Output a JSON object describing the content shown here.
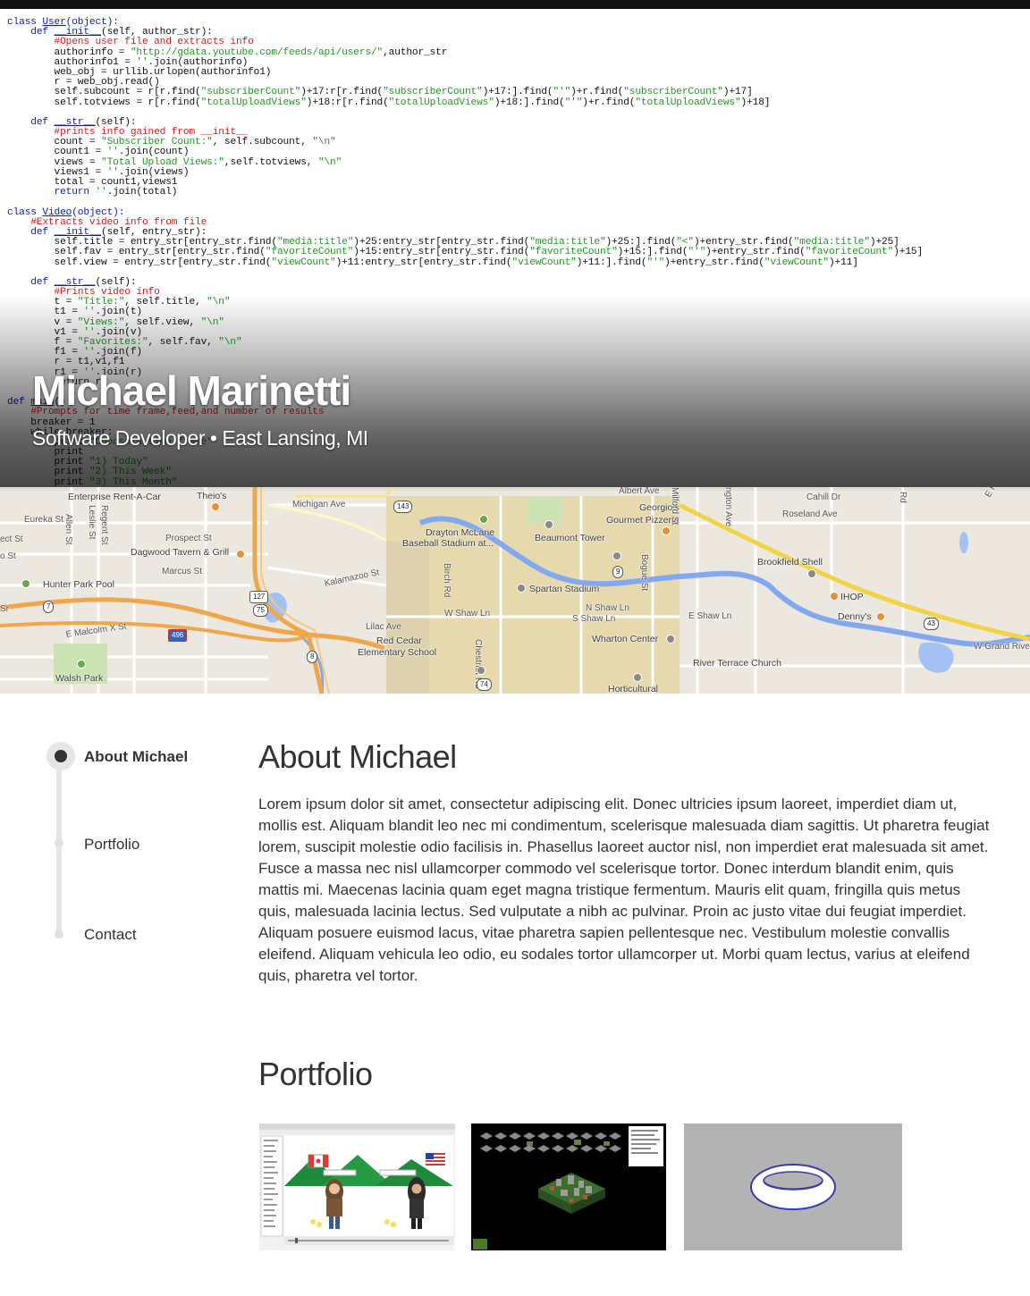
{
  "hero": {
    "name": "Michael Marinetti",
    "subtitle": "Software Developer • East Lansing, MI",
    "code_lines": [
      [
        [
          "k",
          "class "
        ],
        [
          "f",
          "User"
        ],
        [
          "k",
          "(object):"
        ]
      ],
      [
        [
          "k",
          "    def "
        ],
        [
          "f",
          "__init__"
        ],
        [
          "p",
          "(self, author_str):"
        ]
      ],
      [
        [
          "c",
          "        #Opens user file and extracts info"
        ]
      ],
      [
        [
          "p",
          "        authorinfo = "
        ],
        [
          "s",
          "\"http://gdata.youtube.com/feeds/api/users/\""
        ],
        [
          "p",
          ",author_str"
        ]
      ],
      [
        [
          "p",
          "        authorinfo1 = "
        ],
        [
          "s",
          "''"
        ],
        [
          "p",
          ".join(authorinfo)"
        ]
      ],
      [
        [
          "p",
          "        web_obj = urllib.urlopen(authorinfo1)"
        ]
      ],
      [
        [
          "p",
          "        r = web_obj.read()"
        ]
      ],
      [
        [
          "p",
          "        self.subcount = r[r.find("
        ],
        [
          "s",
          "\"subscriberCount\""
        ],
        [
          "p",
          ")+17:r[r.find("
        ],
        [
          "s",
          "\"subscriberCount\""
        ],
        [
          "p",
          ")+17:].find("
        ],
        [
          "s",
          "\"'\""
        ],
        [
          "p",
          ")+r.find("
        ],
        [
          "s",
          "\"subscriberCount\""
        ],
        [
          "p",
          ")+17]"
        ]
      ],
      [
        [
          "p",
          "        self.totviews = r[r.find("
        ],
        [
          "s",
          "\"totalUploadViews\""
        ],
        [
          "p",
          ")+18:r[r.find("
        ],
        [
          "s",
          "\"totalUploadViews\""
        ],
        [
          "p",
          ")+18:].find("
        ],
        [
          "s",
          "\"'\""
        ],
        [
          "p",
          ")+r.find("
        ],
        [
          "s",
          "\"totalUploadViews\""
        ],
        [
          "p",
          ")+18]"
        ]
      ],
      [
        [
          "p",
          ""
        ]
      ],
      [
        [
          "k",
          "    def "
        ],
        [
          "f",
          "__str__"
        ],
        [
          "p",
          "(self):"
        ]
      ],
      [
        [
          "c",
          "        #prints info gained from __init__"
        ]
      ],
      [
        [
          "p",
          "        count = "
        ],
        [
          "s",
          "\"Subscriber Count:\""
        ],
        [
          "p",
          ", self.subcount, "
        ],
        [
          "s",
          "\"\\n\""
        ]
      ],
      [
        [
          "p",
          "        count1 = "
        ],
        [
          "s",
          "''"
        ],
        [
          "p",
          ".join(count)"
        ]
      ],
      [
        [
          "p",
          "        views = "
        ],
        [
          "s",
          "\"Total Upload Views:\""
        ],
        [
          "p",
          ",self.totviews, "
        ],
        [
          "s",
          "\"\\n\""
        ]
      ],
      [
        [
          "p",
          "        views1 = "
        ],
        [
          "s",
          "''"
        ],
        [
          "p",
          ".join(views)"
        ]
      ],
      [
        [
          "p",
          "        total = count1,views1"
        ]
      ],
      [
        [
          "k",
          "        return "
        ],
        [
          "s",
          "''"
        ],
        [
          "p",
          ".join(total)"
        ]
      ],
      [
        [
          "p",
          ""
        ]
      ],
      [
        [
          "k",
          "class "
        ],
        [
          "f",
          "Video"
        ],
        [
          "k",
          "(object):"
        ]
      ],
      [
        [
          "c",
          "    #Extracts video info from file"
        ]
      ],
      [
        [
          "k",
          "    def "
        ],
        [
          "f",
          "__init__"
        ],
        [
          "p",
          "(self, entry_str):"
        ]
      ],
      [
        [
          "p",
          "        self.title = entry_str[entry_str.find("
        ],
        [
          "s",
          "\"media:title\""
        ],
        [
          "p",
          ")+25:entry_str[entry_str.find("
        ],
        [
          "s",
          "\"media:title\""
        ],
        [
          "p",
          ")+25:].find("
        ],
        [
          "s",
          "\"<\""
        ],
        [
          "p",
          ")+entry_str.find("
        ],
        [
          "s",
          "\"media:title\""
        ],
        [
          "p",
          ")+25]"
        ]
      ],
      [
        [
          "p",
          "        self.fav = entry_str[entry_str.find("
        ],
        [
          "s",
          "\"favoriteCount\""
        ],
        [
          "p",
          ")+15:entry_str[entry_str.find("
        ],
        [
          "s",
          "\"favoriteCount\""
        ],
        [
          "p",
          ")+15:].find("
        ],
        [
          "s",
          "\"'\""
        ],
        [
          "p",
          ")+entry_str.find("
        ],
        [
          "s",
          "\"favoriteCount\""
        ],
        [
          "p",
          ")+15]"
        ]
      ],
      [
        [
          "p",
          "        self.view = entry_str[entry_str.find("
        ],
        [
          "s",
          "\"viewCount\""
        ],
        [
          "p",
          ")+11:entry_str[entry_str.find("
        ],
        [
          "s",
          "\"viewCount\""
        ],
        [
          "p",
          ")+11:].find("
        ],
        [
          "s",
          "\"'\""
        ],
        [
          "p",
          ")+entry_str.find("
        ],
        [
          "s",
          "\"viewCount\""
        ],
        [
          "p",
          ")+11]"
        ]
      ],
      [
        [
          "p",
          ""
        ]
      ],
      [
        [
          "k",
          "    def "
        ],
        [
          "f",
          "__str__"
        ],
        [
          "p",
          "(self):"
        ]
      ],
      [
        [
          "c",
          "        #Prints video info"
        ]
      ],
      [
        [
          "p",
          "        t = "
        ],
        [
          "s",
          "\"Title:\""
        ],
        [
          "p",
          ", self.title, "
        ],
        [
          "s",
          "\"\\n\""
        ]
      ],
      [
        [
          "p",
          "        t1 = "
        ],
        [
          "s",
          "''"
        ],
        [
          "p",
          ".join(t)"
        ]
      ],
      [
        [
          "p",
          "        v = "
        ],
        [
          "s",
          "\"Views:\""
        ],
        [
          "p",
          ", self.view, "
        ],
        [
          "s",
          "\"\\n\""
        ]
      ],
      [
        [
          "p",
          "        v1 = "
        ],
        [
          "s",
          "''"
        ],
        [
          "p",
          ".join(v)"
        ]
      ],
      [
        [
          "p",
          "        f = "
        ],
        [
          "s",
          "\"Favorites:\""
        ],
        [
          "p",
          ", self.fav, "
        ],
        [
          "s",
          "\"\\n\""
        ]
      ],
      [
        [
          "p",
          "        f1 = "
        ],
        [
          "s",
          "''"
        ],
        [
          "p",
          ".join(f)"
        ]
      ],
      [
        [
          "p",
          "        r = t1,v1,f1"
        ]
      ],
      [
        [
          "p",
          "        r1 = "
        ],
        [
          "s",
          "''"
        ],
        [
          "p",
          ".join(r)"
        ]
      ],
      [
        [
          "p",
          "        return r1"
        ]
      ],
      [
        [
          "p",
          ""
        ]
      ],
      [
        [
          "k",
          "def "
        ],
        [
          "f",
          "main"
        ],
        [
          "p",
          "():"
        ]
      ],
      [
        [
          "c",
          "    #Prompts for time frame,feed,and number of results"
        ]
      ],
      [
        [
          "p",
          "    breaker = 1"
        ]
      ],
      [
        [
          "p",
          "    while breaker:"
        ]
      ],
      [
        [
          "p",
          "        print "
        ],
        [
          "s",
          "\"Choose a time frame\""
        ]
      ],
      [
        [
          "p",
          "        print"
        ]
      ],
      [
        [
          "p",
          "        print "
        ],
        [
          "s",
          "\"1) Today\""
        ]
      ],
      [
        [
          "p",
          "        print "
        ],
        [
          "s",
          "\"2) This Week\""
        ]
      ],
      [
        [
          "p",
          "        print "
        ],
        [
          "s",
          "\"3) This Month\""
        ]
      ]
    ]
  },
  "map": {
    "labels": [
      {
        "text": "Enterprise Rent-A-Car",
        "cls": ""
      },
      {
        "text": "Theio's",
        "cls": ""
      },
      {
        "text": "Michigan Ave",
        "cls": "street"
      },
      {
        "text": "Albert Ave",
        "cls": "street"
      },
      {
        "text": "Georgio's",
        "cls": ""
      },
      {
        "text": "Gourmet Pizzeria",
        "cls": ""
      },
      {
        "text": "Cahill Dr",
        "cls": "street"
      },
      {
        "text": "Roseland Ave",
        "cls": "street"
      },
      {
        "text": "Eureka St",
        "cls": "street"
      },
      {
        "text": "Prospect St",
        "cls": "street"
      },
      {
        "text": "Dagwood Tavern & Grill",
        "cls": ""
      },
      {
        "text": "Marcus St",
        "cls": "street"
      },
      {
        "text": "Drayton McLane",
        "cls": ""
      },
      {
        "text": "Baseball Stadium at...",
        "cls": ""
      },
      {
        "text": "Beaumont Tower",
        "cls": ""
      },
      {
        "text": "Brookfield Shell",
        "cls": ""
      },
      {
        "text": "Hunter Park Pool",
        "cls": ""
      },
      {
        "text": "Kalamazoo St",
        "cls": "street"
      },
      {
        "text": "Spartan Stadium",
        "cls": ""
      },
      {
        "text": "IHOP",
        "cls": ""
      },
      {
        "text": "Denny's",
        "cls": ""
      },
      {
        "text": "E Malcolm X St",
        "cls": "street"
      },
      {
        "text": "W Shaw Ln",
        "cls": "street"
      },
      {
        "text": "N Shaw Ln",
        "cls": "street"
      },
      {
        "text": "S Shaw Ln",
        "cls": "street"
      },
      {
        "text": "E Shaw Ln",
        "cls": "street"
      },
      {
        "text": "Lilac Ave",
        "cls": "street"
      },
      {
        "text": "Red Cedar",
        "cls": ""
      },
      {
        "text": "Elementary School",
        "cls": ""
      },
      {
        "text": "Wharton Center",
        "cls": ""
      },
      {
        "text": "River Terrace Church",
        "cls": ""
      },
      {
        "text": "W Grand River",
        "cls": "street"
      },
      {
        "text": "Walsh Park",
        "cls": ""
      },
      {
        "text": "Horticultural",
        "cls": ""
      },
      {
        "text": "Birch Rd",
        "cls": "street"
      },
      {
        "text": "Chestnut Rd",
        "cls": "street"
      },
      {
        "text": "Bogue St",
        "cls": "street"
      },
      {
        "text": "Milford St",
        "cls": "street"
      },
      {
        "text": "Allen St",
        "cls": "street"
      },
      {
        "text": "Leslie St",
        "cls": "street"
      },
      {
        "text": "Regent St",
        "cls": "street"
      },
      {
        "text": "ect St",
        "cls": "street"
      },
      {
        "text": "o St",
        "cls": "street"
      },
      {
        "text": "Sr",
        "cls": "street"
      },
      {
        "text": "E Hidden",
        "cls": "street"
      },
      {
        "text": "Rd",
        "cls": "street"
      },
      {
        "text": "ngton Ave",
        "cls": "street"
      }
    ],
    "shields": [
      "143",
      "127",
      "75",
      "496",
      "43",
      "7",
      "8",
      "9",
      "74"
    ]
  },
  "nav": {
    "items": [
      {
        "label": "About Michael",
        "active": true
      },
      {
        "label": "Portfolio",
        "active": false
      },
      {
        "label": "Contact",
        "active": false
      }
    ]
  },
  "about": {
    "title": "About Michael",
    "body": "Lorem ipsum dolor sit amet, consectetur adipiscing elit. Donec ultricies ipsum laoreet, imperdiet diam ut, mollis est. Aliquam blandit leo nec mi condimentum, scelerisque malesuada diam sagittis. Ut pharetra feugiat lorem, suscipit molestie odio facilisis in. Phasellus laoreet auctor nisl, non imperdiet erat malesuada sit amet. Fusce a massa nec nisl ullamcorper commodo vel scelerisque tortor. Donec interdum blandit enim, quis mattis mi. Maecenas lacinia quam eget magna tristique fermentum. Mauris elit quam, fringilla quis metus quis, malesuada lacinia lectus. Sed vulputate a nibh ac pulvinar. Proin ac justo vitae dui feugiat imperdiet. Aliquam posuere euismod lacus, vitae pharetra sapien pellentesque nec. Vestibulum molestie convallis eleifend. Aliquam vehicula leo odio, eu sodales tortor ullamcorper ut. Morbi quam lectus, varius at eleifend quis, pharetra vel tortor."
  },
  "portfolio": {
    "title": "Portfolio",
    "items": [
      {
        "kind": "cartoon-app"
      },
      {
        "kind": "isometric-game"
      },
      {
        "kind": "torus-render"
      }
    ]
  }
}
